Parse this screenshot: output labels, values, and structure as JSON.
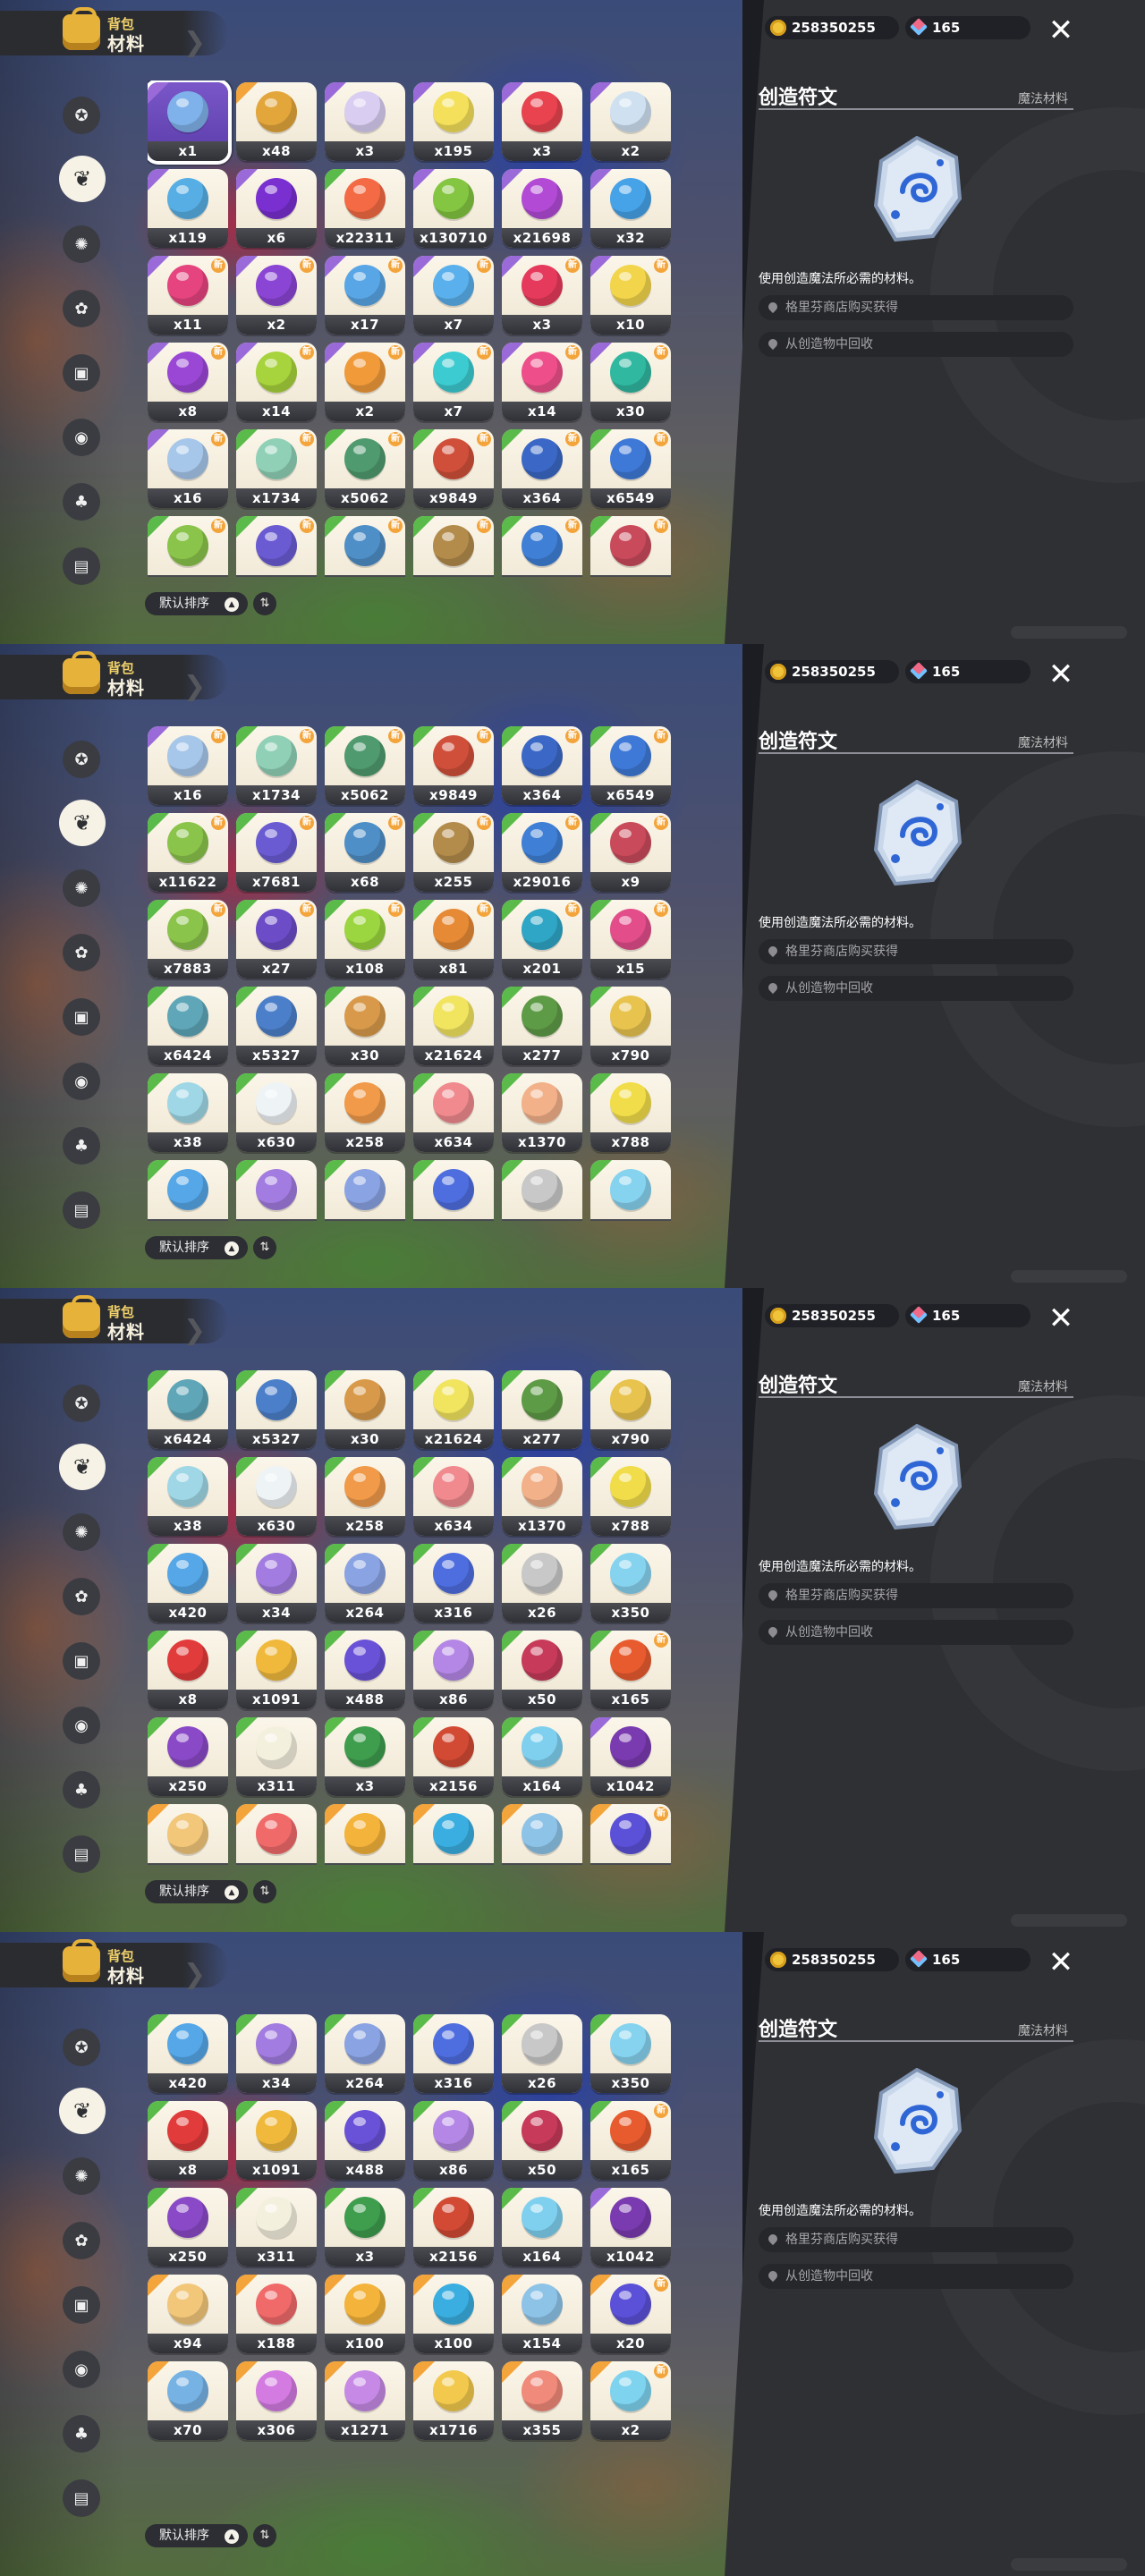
{
  "header": {
    "subtitle": "背包",
    "title": "材料"
  },
  "sort": {
    "label": "默认排序",
    "asc_glyph": "▲",
    "toggle_glyph": "⇅"
  },
  "currency": {
    "gold": "258350255",
    "gems": "165"
  },
  "close_glyph": "✕",
  "detail": {
    "title": "创造符文",
    "type": "魔法材料",
    "description": "使用创造魔法所必需的材料。",
    "sources": [
      "格里芬商店购买获得",
      "从创造物中回收"
    ]
  },
  "categories": [
    "star-icon",
    "leaf-icon",
    "sun-icon",
    "sprout-icon",
    "box-icon",
    "ball-icon",
    "acorn-icon",
    "chest-icon"
  ],
  "selected_category_index": 1,
  "badge_glyph": "新",
  "colors": {
    "gold": "#f0c43a",
    "panel": "#2f3034",
    "badge": "#f3a43b",
    "rarity_purple": "#9a6bd8",
    "rarity_green": "#5bbb4a",
    "rarity_orange": "#f3a43b"
  },
  "inventory": [
    {
      "qty": "x1",
      "color": "#7fb2ea",
      "rarity": "purple",
      "badge": false,
      "selected": true
    },
    {
      "qty": "x48",
      "color": "#e3a63b",
      "rarity": "orange",
      "badge": false
    },
    {
      "qty": "x3",
      "color": "#d9cdf1",
      "rarity": "purple",
      "badge": false
    },
    {
      "qty": "x195",
      "color": "#f4e05a",
      "rarity": "purple",
      "badge": false
    },
    {
      "qty": "x3",
      "color": "#e8434e",
      "rarity": "purple",
      "badge": false
    },
    {
      "qty": "x2",
      "color": "#cfe1f1",
      "rarity": "purple",
      "badge": false
    },
    {
      "qty": "x119",
      "color": "#57aee4",
      "rarity": "purple",
      "badge": false
    },
    {
      "qty": "x6",
      "color": "#7a2fd1",
      "rarity": "purple",
      "badge": false
    },
    {
      "qty": "x22311",
      "color": "#f36a44",
      "rarity": "green",
      "badge": false
    },
    {
      "qty": "x130710",
      "color": "#84c641",
      "rarity": "purple",
      "badge": false
    },
    {
      "qty": "x21698",
      "color": "#b24ad6",
      "rarity": "purple",
      "badge": false
    },
    {
      "qty": "x32",
      "color": "#46a3e8",
      "rarity": "purple",
      "badge": false
    },
    {
      "qty": "x11",
      "color": "#e5447e",
      "rarity": "purple",
      "badge": true
    },
    {
      "qty": "x2",
      "color": "#8b45d4",
      "rarity": "purple",
      "badge": true
    },
    {
      "qty": "x17",
      "color": "#59a6e6",
      "rarity": "purple",
      "badge": true
    },
    {
      "qty": "x7",
      "color": "#5ab0ec",
      "rarity": "purple",
      "badge": true
    },
    {
      "qty": "x3",
      "color": "#e53a5b",
      "rarity": "purple",
      "badge": true
    },
    {
      "qty": "x10",
      "color": "#f2d54a",
      "rarity": "purple",
      "badge": true
    },
    {
      "qty": "x8",
      "color": "#9a47d6",
      "rarity": "purple",
      "badge": true
    },
    {
      "qty": "x14",
      "color": "#a7d33c",
      "rarity": "purple",
      "badge": true
    },
    {
      "qty": "x2",
      "color": "#f09a3a",
      "rarity": "purple",
      "badge": true
    },
    {
      "qty": "x7",
      "color": "#3ccbd0",
      "rarity": "purple",
      "badge": true
    },
    {
      "qty": "x14",
      "color": "#ee4f8a",
      "rarity": "purple",
      "badge": true
    },
    {
      "qty": "x30",
      "color": "#30b8a0",
      "rarity": "purple",
      "badge": true
    },
    {
      "qty": "x16",
      "color": "#a7c7ea",
      "rarity": "purple",
      "badge": true
    },
    {
      "qty": "x1734",
      "color": "#8fd0b6",
      "rarity": "green",
      "badge": true
    },
    {
      "qty": "x5062",
      "color": "#4f9a6e",
      "rarity": "green",
      "badge": true
    },
    {
      "qty": "x9849",
      "color": "#d04f3a",
      "rarity": "green",
      "badge": true
    },
    {
      "qty": "x364",
      "color": "#3b68c6",
      "rarity": "green",
      "badge": true
    },
    {
      "qty": "x6549",
      "color": "#3f79d8",
      "rarity": "green",
      "badge": true
    },
    {
      "qty": "x11622",
      "color": "#8ac44a",
      "rarity": "green",
      "badge": true
    },
    {
      "qty": "x7681",
      "color": "#6a5bd3",
      "rarity": "green",
      "badge": true
    },
    {
      "qty": "x68",
      "color": "#4f8fc7",
      "rarity": "green",
      "badge": true
    },
    {
      "qty": "x255",
      "color": "#b38b4a",
      "rarity": "green",
      "badge": true
    },
    {
      "qty": "x29016",
      "color": "#3f7fd6",
      "rarity": "green",
      "badge": true
    },
    {
      "qty": "x9",
      "color": "#c94a5b",
      "rarity": "green",
      "badge": true
    },
    {
      "qty": "x7883",
      "color": "#8ac44a",
      "rarity": "green",
      "badge": true
    },
    {
      "qty": "x27",
      "color": "#6d4cc7",
      "rarity": "green",
      "badge": true
    },
    {
      "qty": "x108",
      "color": "#9bd53f",
      "rarity": "green",
      "badge": true
    },
    {
      "qty": "x81",
      "color": "#e68a35",
      "rarity": "green",
      "badge": true
    },
    {
      "qty": "x201",
      "color": "#2fa6c6",
      "rarity": "green",
      "badge": true
    },
    {
      "qty": "x15",
      "color": "#e24d8a",
      "rarity": "green",
      "badge": true
    },
    {
      "qty": "x6424",
      "color": "#5fa6b8",
      "rarity": "green",
      "badge": false
    },
    {
      "qty": "x5327",
      "color": "#4c7fca",
      "rarity": "green",
      "badge": false
    },
    {
      "qty": "x30",
      "color": "#d89a4a",
      "rarity": "green",
      "badge": false
    },
    {
      "qty": "x21624",
      "color": "#f1e45f",
      "rarity": "green",
      "badge": false
    },
    {
      "qty": "x277",
      "color": "#5e9b46",
      "rarity": "green",
      "badge": false
    },
    {
      "qty": "x790",
      "color": "#e8c44e",
      "rarity": "green",
      "badge": false
    },
    {
      "qty": "x38",
      "color": "#9fd7e6",
      "rarity": "green",
      "badge": false
    },
    {
      "qty": "x630",
      "color": "#eef3f6",
      "rarity": "green",
      "badge": false
    },
    {
      "qty": "x258",
      "color": "#f09a4a",
      "rarity": "green",
      "badge": false
    },
    {
      "qty": "x634",
      "color": "#f08a8e",
      "rarity": "green",
      "badge": false
    },
    {
      "qty": "x1370",
      "color": "#f2b189",
      "rarity": "green",
      "badge": false
    },
    {
      "qty": "x788",
      "color": "#f1dd49",
      "rarity": "green",
      "badge": false
    },
    {
      "qty": "x420",
      "color": "#55a7e8",
      "rarity": "green",
      "badge": false
    },
    {
      "qty": "x34",
      "color": "#a27ce0",
      "rarity": "green",
      "badge": false
    },
    {
      "qty": "x264",
      "color": "#8aa3e3",
      "rarity": "green",
      "badge": false
    },
    {
      "qty": "x316",
      "color": "#4e6ee0",
      "rarity": "green",
      "badge": false
    },
    {
      "qty": "x26",
      "color": "#c8c8c8",
      "rarity": "green",
      "badge": false
    },
    {
      "qty": "x350",
      "color": "#86d3ef",
      "rarity": "green",
      "badge": false
    },
    {
      "qty": "x8",
      "color": "#e23b3b",
      "rarity": "green",
      "badge": false
    },
    {
      "qty": "x1091",
      "color": "#f0b93c",
      "rarity": "green",
      "badge": false
    },
    {
      "qty": "x488",
      "color": "#6a52d8",
      "rarity": "green",
      "badge": false
    },
    {
      "qty": "x86",
      "color": "#b487e6",
      "rarity": "green",
      "badge": false
    },
    {
      "qty": "x50",
      "color": "#c73a5a",
      "rarity": "green",
      "badge": false
    },
    {
      "qty": "x165",
      "color": "#e85b2f",
      "rarity": "green",
      "badge": true
    },
    {
      "qty": "x250",
      "color": "#8a49c7",
      "rarity": "green",
      "badge": false
    },
    {
      "qty": "x311",
      "color": "#f4f0de",
      "rarity": "green",
      "badge": false
    },
    {
      "qty": "x3",
      "color": "#3f9d4e",
      "rarity": "green",
      "badge": false
    },
    {
      "qty": "x2156",
      "color": "#d24a34",
      "rarity": "green",
      "badge": false
    },
    {
      "qty": "x164",
      "color": "#7fd0ef",
      "rarity": "green",
      "badge": false
    },
    {
      "qty": "x1042",
      "color": "#7a3ab0",
      "rarity": "purple",
      "badge": false
    },
    {
      "qty": "x94",
      "color": "#f2c77a",
      "rarity": "orange",
      "badge": false
    },
    {
      "qty": "x188",
      "color": "#f16a6a",
      "rarity": "orange",
      "badge": false
    },
    {
      "qty": "x100",
      "color": "#f4b33a",
      "rarity": "orange",
      "badge": false
    },
    {
      "qty": "x100",
      "color": "#3aaee0",
      "rarity": "orange",
      "badge": false
    },
    {
      "qty": "x154",
      "color": "#8ec3e8",
      "rarity": "orange",
      "badge": false
    },
    {
      "qty": "x20",
      "color": "#5b50d8",
      "rarity": "orange",
      "badge": true
    },
    {
      "qty": "x70",
      "color": "#76b2e4",
      "rarity": "orange",
      "badge": false
    },
    {
      "qty": "x306",
      "color": "#d37be1",
      "rarity": "orange",
      "badge": false
    },
    {
      "qty": "x1271",
      "color": "#c68ae6",
      "rarity": "orange",
      "badge": false
    },
    {
      "qty": "x1716",
      "color": "#f2c94c",
      "rarity": "orange",
      "badge": false
    },
    {
      "qty": "x355",
      "color": "#f08a7a",
      "rarity": "orange",
      "badge": false
    },
    {
      "qty": "x2",
      "color": "#7ed3ef",
      "rarity": "orange",
      "badge": true
    }
  ],
  "scroll_offsets_rows": [
    0,
    4,
    7,
    9
  ]
}
